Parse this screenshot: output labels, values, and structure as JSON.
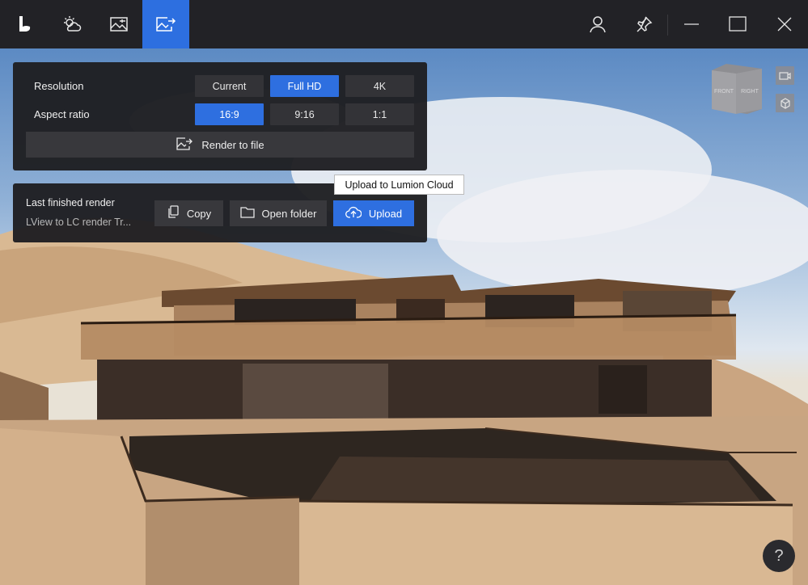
{
  "titlebar": {
    "icons": [
      "lumion-logo-icon",
      "weather-icon",
      "image-settings-icon",
      "render-export-icon",
      "user-icon",
      "pin-icon",
      "minimize-icon",
      "maximize-icon",
      "close-icon"
    ],
    "active_tab": "render-export-icon"
  },
  "settings": {
    "resolution_label": "Resolution",
    "resolution_options": [
      "Current",
      "Full HD",
      "4K"
    ],
    "resolution_selected": "Full HD",
    "aspect_label": "Aspect ratio",
    "aspect_options": [
      "16:9",
      "9:16",
      "1:1"
    ],
    "aspect_selected": "16:9",
    "render_button": "Render to file"
  },
  "last_render": {
    "title": "Last finished render",
    "filename": "LView to LC render Tr...",
    "copy_label": "Copy",
    "open_folder_label": "Open folder",
    "upload_label": "Upload"
  },
  "tooltip": "Upload to Lumion Cloud",
  "nav_cube": {
    "front": "FRONT",
    "right": "RIGHT"
  },
  "help_label": "?",
  "colors": {
    "accent": "#2e6fe0",
    "panel": "#1e1e21",
    "titlebar": "#222226"
  }
}
